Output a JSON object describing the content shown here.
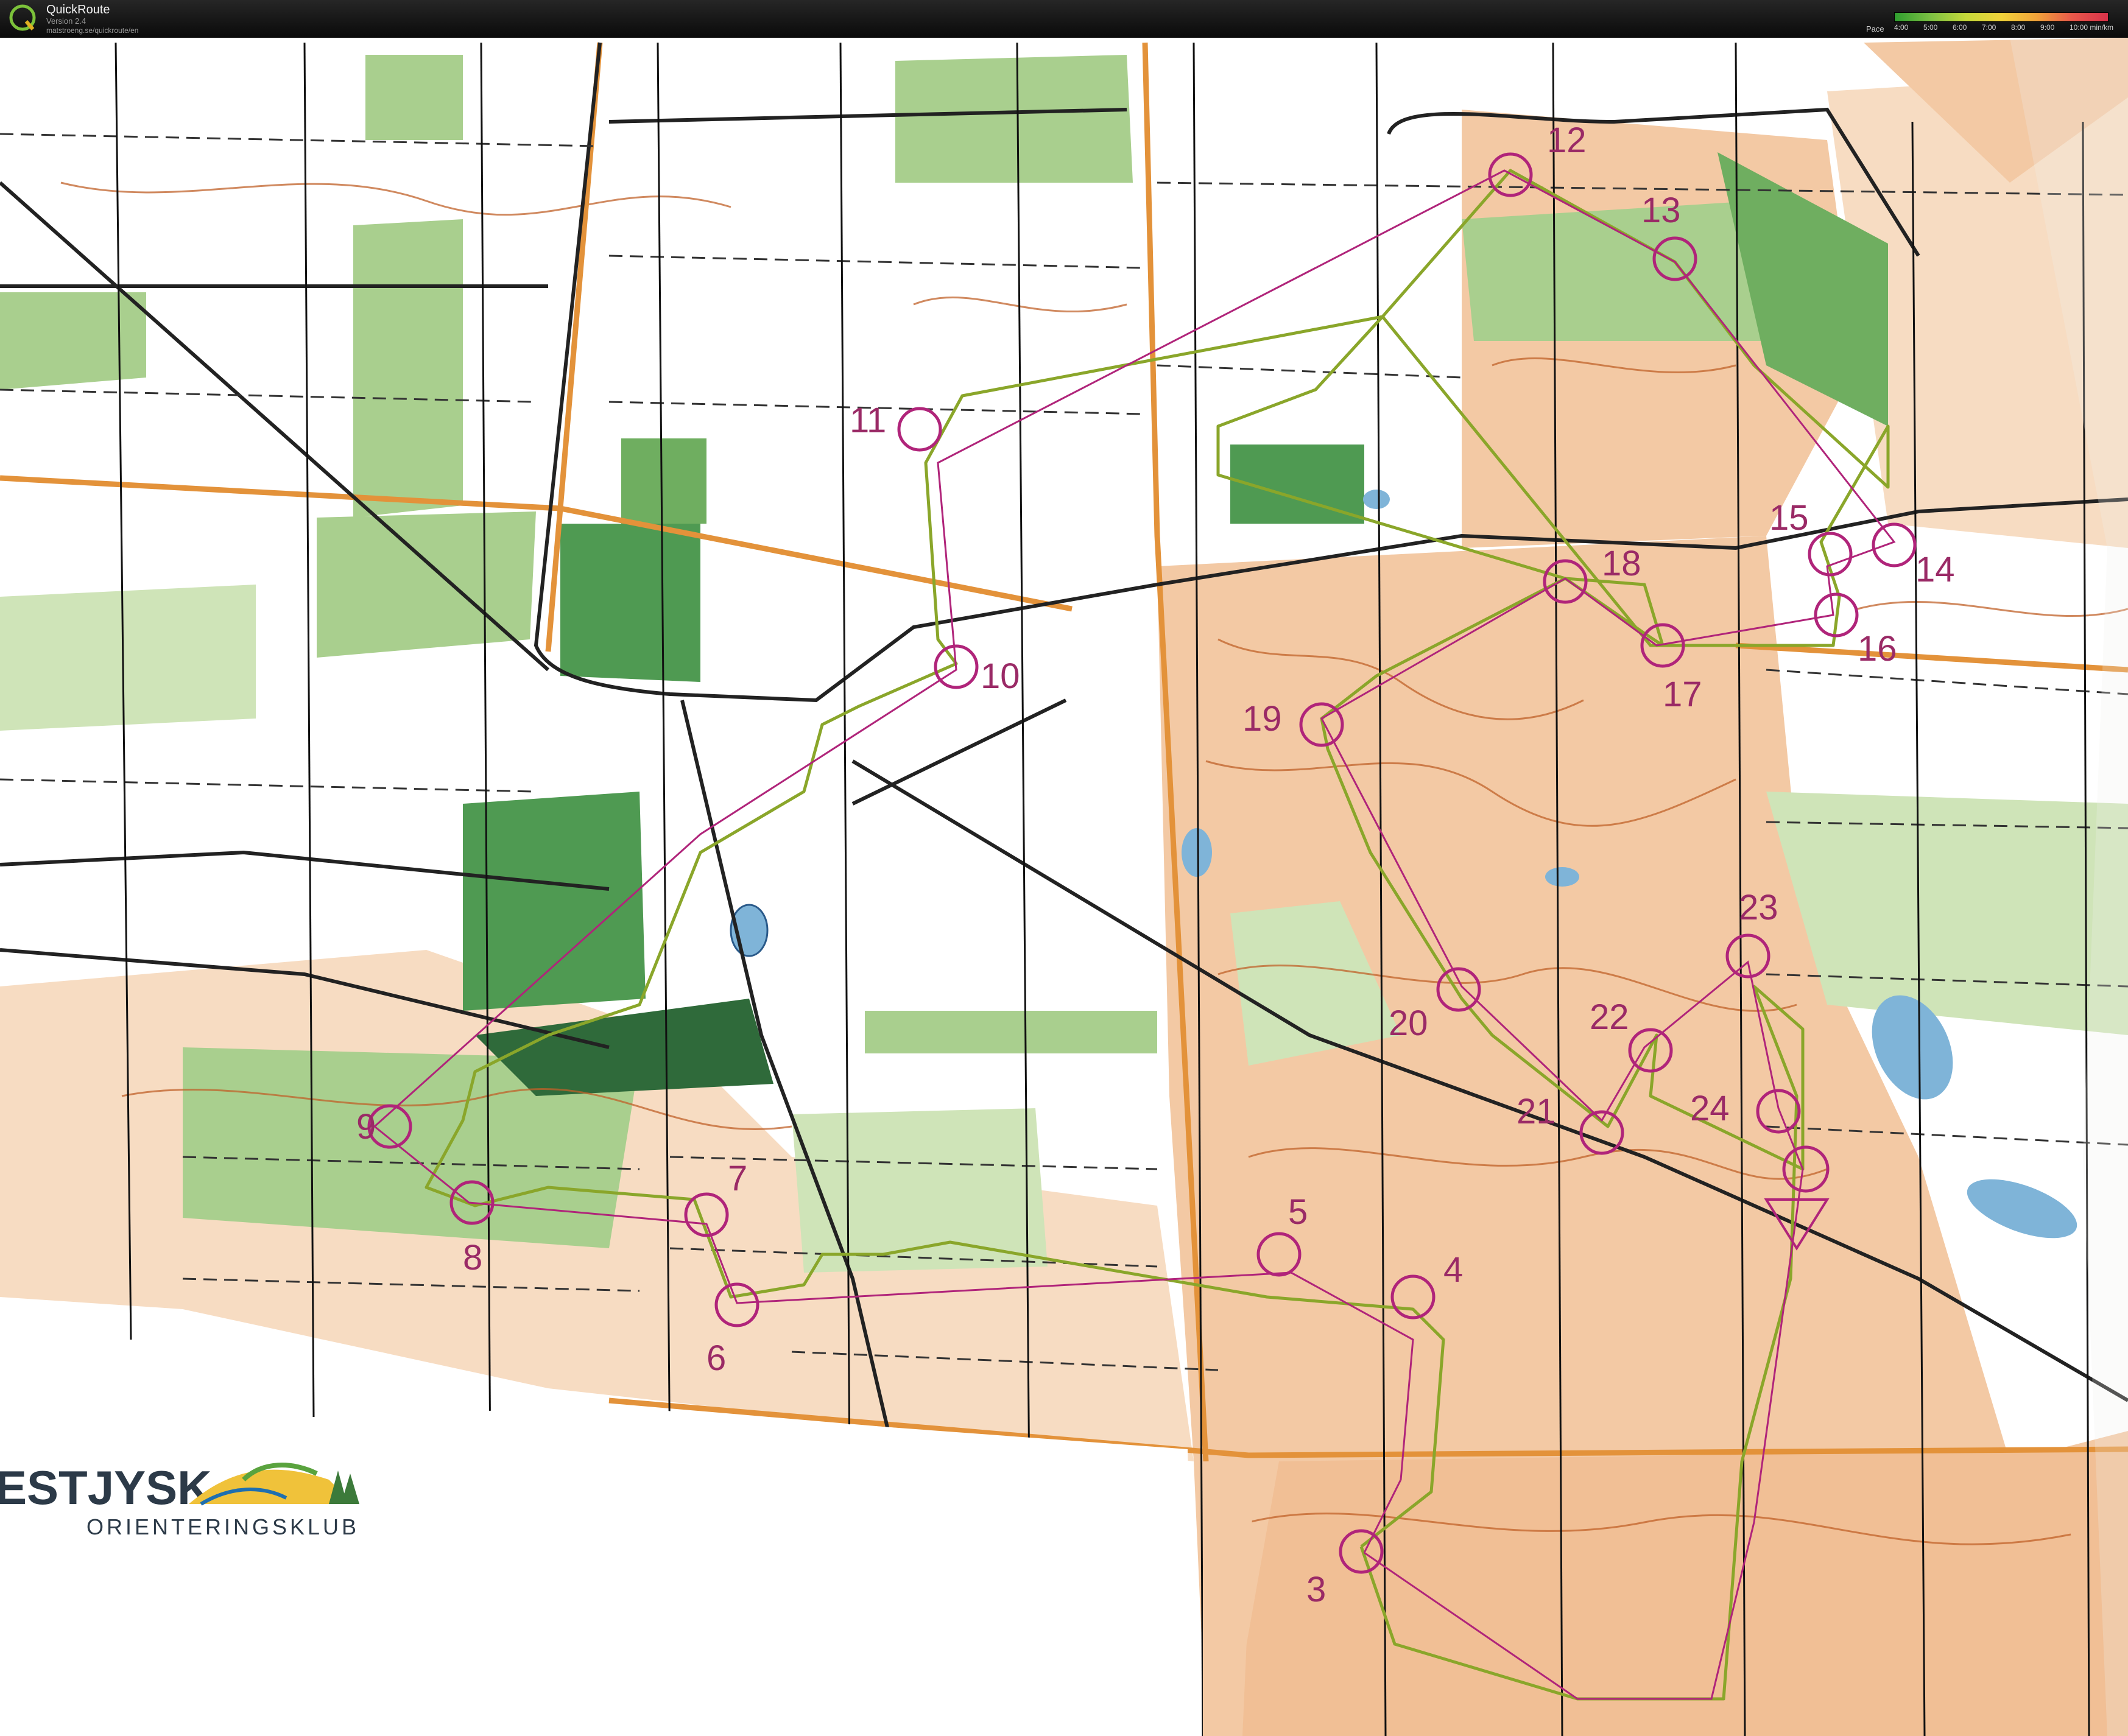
{
  "app": {
    "title": "QuickRoute",
    "version": "Version 2.4",
    "url": "matstroeng.se/quickroute/en",
    "logo_letter": "Q"
  },
  "pace_legend": {
    "label": "Pace",
    "ticks": [
      "4:00",
      "5:00",
      "6:00",
      "7:00",
      "8:00",
      "9:00",
      "10:00 min/km"
    ]
  },
  "club_logo": {
    "name_line1": "ESTJYSK",
    "name_line2": "ORIENTERINGSKLUB"
  },
  "controls": [
    {
      "label": "3"
    },
    {
      "label": "4"
    },
    {
      "label": "5"
    },
    {
      "label": "6"
    },
    {
      "label": "7"
    },
    {
      "label": "8"
    },
    {
      "label": "9"
    },
    {
      "label": "10"
    },
    {
      "label": "11"
    },
    {
      "label": "12"
    },
    {
      "label": "13"
    },
    {
      "label": "14"
    },
    {
      "label": "15"
    },
    {
      "label": "16"
    },
    {
      "label": "17"
    },
    {
      "label": "18"
    },
    {
      "label": "19"
    },
    {
      "label": "20"
    },
    {
      "label": "21"
    },
    {
      "label": "22"
    },
    {
      "label": "23"
    },
    {
      "label": "24"
    }
  ],
  "colors": {
    "map_white": "#ffffff",
    "open_land": "#f3c9a4",
    "rough_open": "#f7dcc2",
    "forest_green": "#a9cf8e",
    "dark_green": "#4f9a52",
    "light_green": "#cfe4b8",
    "contour": "#c0622a",
    "road": "#222222",
    "paved_road": "#e3923a",
    "water": "#7fb4d8",
    "course": "#b0247a",
    "gps_route": "#8aa62a",
    "label_text": "#9a2a66"
  }
}
